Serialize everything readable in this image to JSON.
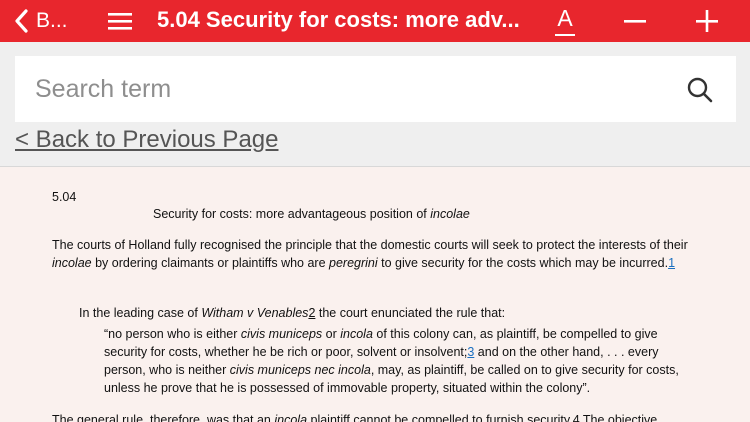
{
  "header": {
    "back_label": "B...",
    "title": "5.04 Security for costs: more adv...",
    "font_button_glyph": "A",
    "accent_color": "#e8262d",
    "icons": [
      "chevron-left-icon",
      "hamburger-menu-icon",
      "font-size-icon",
      "minus-icon",
      "plus-icon"
    ]
  },
  "search": {
    "placeholder": "Search term",
    "value": ""
  },
  "nav": {
    "back_link": "< Back to Previous Page"
  },
  "content": {
    "section_number": "5.04",
    "section_title_prefix": "Security for costs: more advantageous position of ",
    "section_title_italic": "incolae",
    "para1_a": "The courts of Holland fully recognised the principle that the domestic courts will seek to protect the interests of their ",
    "para1_b": "incolae",
    "para1_c": " by ordering claimants or plaintiffs who are ",
    "para1_d": "peregrini",
    "para1_e": " to give security for the costs which may be incurred.",
    "para1_fn": "1",
    "para2_a": "In the leading case of ",
    "para2_b": "Witham v Venables",
    "para2_fn": "2",
    "para2_c": " the court enunciated the rule that:",
    "quote_a": "“no person who is either ",
    "quote_b": "civis municeps",
    "quote_c": " or ",
    "quote_d": "incola",
    "quote_e": " of this colony can, as plaintiff, be compelled to give security for costs, whether he be rich or poor, solvent or insolvent;",
    "quote_fn": "3",
    "quote_f": " and on the other hand, . . . every person, who is neither ",
    "quote_g": "civis municeps nec incola",
    "quote_h": ", may, as plaintiff, be called on to give security for costs, unless he prove that he is possessed of immovable property, situated within the colony”.",
    "para3_a": "The general rule, therefore, was that an ",
    "para3_b": "incola",
    "para3_c": " plaintiff cannot be compelled to furnish security.",
    "para3_fn": "4",
    "para3_d": " The objective"
  }
}
